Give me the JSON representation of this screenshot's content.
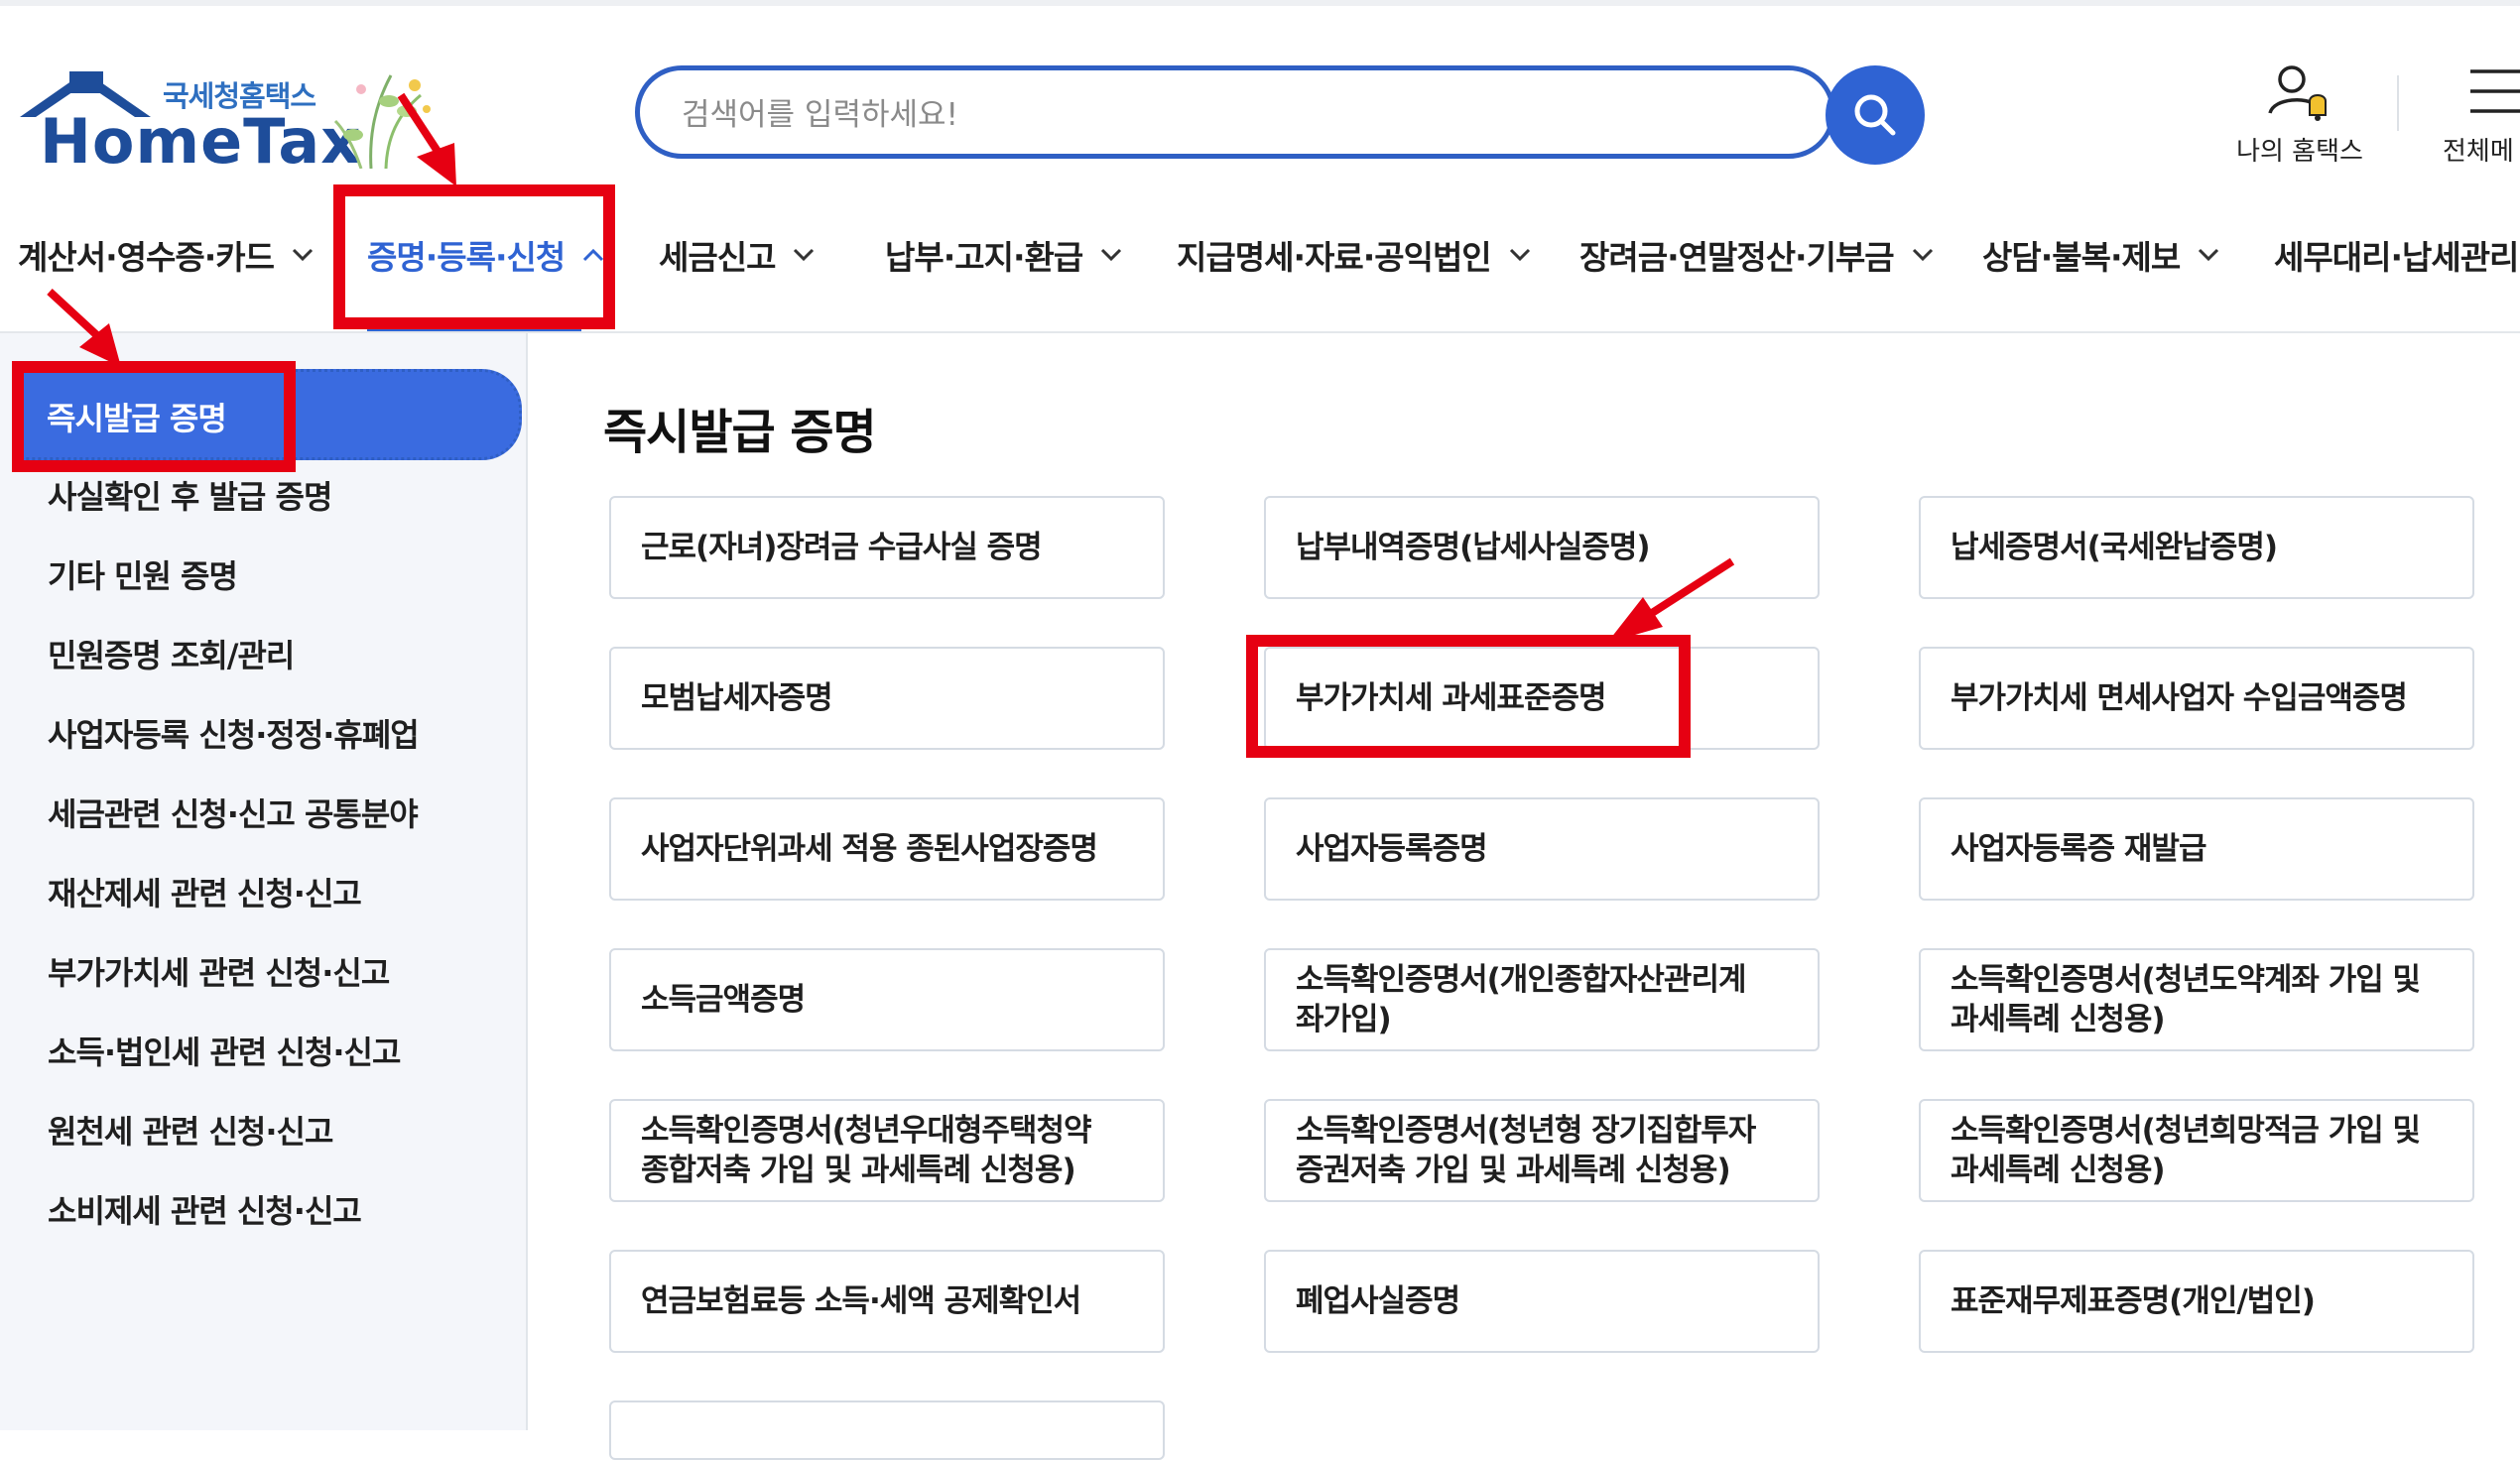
{
  "header": {
    "logo_sub": "국세청홈택스",
    "logo_main": "HomeTax",
    "search_placeholder": "검색어를 입력하세요!",
    "my_hometax_label": "나의 홈택스",
    "all_menu_label": "전체메"
  },
  "gnb": {
    "items": [
      {
        "label": "계산서·영수증·카드"
      },
      {
        "label": "증명·등록·신청"
      },
      {
        "label": "세금신고"
      },
      {
        "label": "납부·고지·환급"
      },
      {
        "label": "지급명세·자료·공익법인"
      },
      {
        "label": "장려금·연말정산·기부금"
      },
      {
        "label": "상담·불복·제보"
      },
      {
        "label": "세무대리·납세관리"
      }
    ]
  },
  "sidebar": {
    "active": "즉시발급 증명",
    "items": [
      {
        "label": "사실확인 후 발급 증명"
      },
      {
        "label": "기타 민원 증명"
      },
      {
        "label": "민원증명 조회/관리"
      },
      {
        "label": "사업자등록 신청·정정·휴폐업"
      },
      {
        "label": "세금관련 신청·신고 공통분야"
      },
      {
        "label": "재산제세 관련 신청·신고"
      },
      {
        "label": "부가가치세 관련 신청·신고"
      },
      {
        "label": "소득·법인세 관련 신청·신고"
      },
      {
        "label": "원천세 관련 신청·신고"
      },
      {
        "label": "소비제세 관련 신청·신고"
      }
    ]
  },
  "content": {
    "title": "즉시발급 증명",
    "cards": [
      {
        "line1": "근로(자녀)장려금 수급사실 증명",
        "line2": ""
      },
      {
        "line1": "납부내역증명(납세사실증명)",
        "line2": ""
      },
      {
        "line1": "납세증명서(국세완납증명)",
        "line2": ""
      },
      {
        "line1": "모범납세자증명",
        "line2": ""
      },
      {
        "line1": "부가가치세 과세표준증명",
        "line2": ""
      },
      {
        "line1": "부가가치세 면세사업자 수입금액증명",
        "line2": ""
      },
      {
        "line1": "사업자단위과세 적용 종된사업장증명",
        "line2": ""
      },
      {
        "line1": "사업자등록증명",
        "line2": ""
      },
      {
        "line1": "사업자등록증 재발급",
        "line2": ""
      },
      {
        "line1": "소득금액증명",
        "line2": ""
      },
      {
        "line1": "소득확인증명서(개인종합자산관리계",
        "line2": "좌가입)"
      },
      {
        "line1": "소득확인증명서(청년도약계좌 가입 및",
        "line2": "과세특례 신청용)"
      },
      {
        "line1": "소득확인증명서(청년우대형주택청약",
        "line2": "종합저축 가입 및 과세특례 신청용)"
      },
      {
        "line1": "소득확인증명서(청년형 장기집합투자",
        "line2": "증권저축 가입 및 과세특례 신청용)"
      },
      {
        "line1": "소득확인증명서(청년희망적금 가입 및",
        "line2": "과세특례 신청용)"
      },
      {
        "line1": "연금보험료등 소득·세액 공제확인서",
        "line2": ""
      },
      {
        "line1": "폐업사실증명",
        "line2": ""
      },
      {
        "line1": "표준재무제표증명(개인/법인)",
        "line2": ""
      }
    ]
  },
  "colors": {
    "accent": "#2f63d3",
    "annotation": "#e60012"
  }
}
